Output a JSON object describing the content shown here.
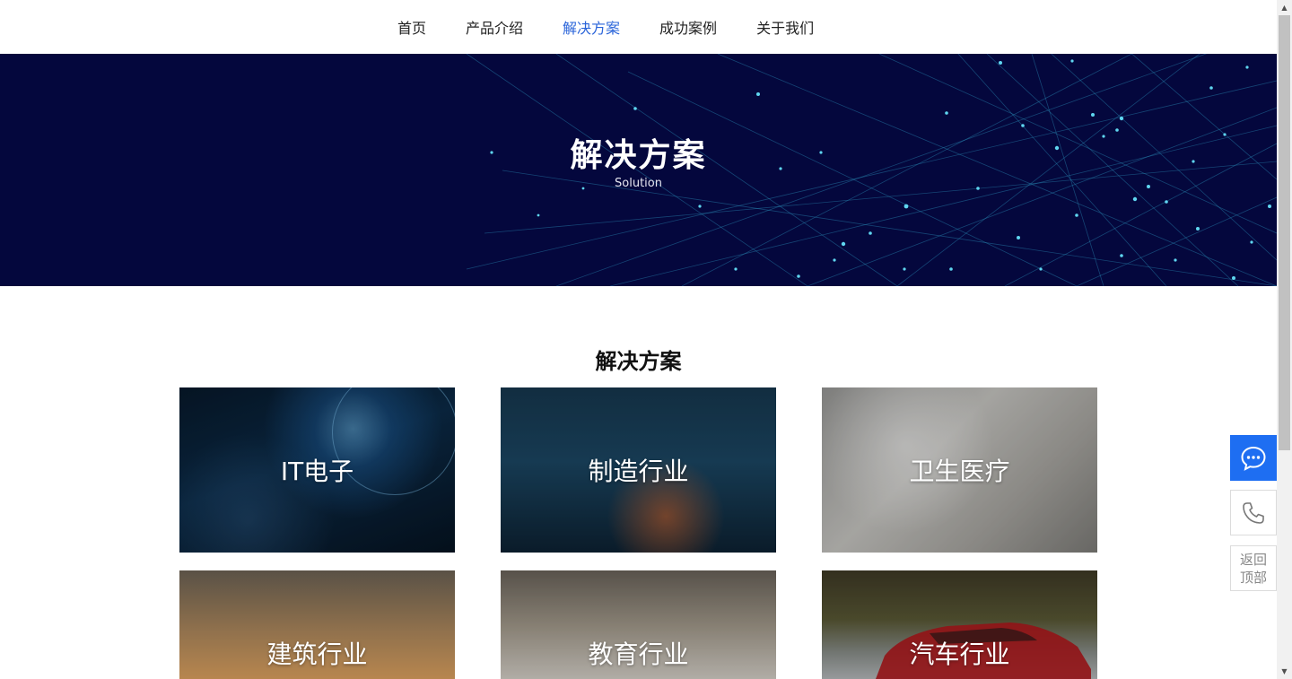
{
  "nav": {
    "items": [
      {
        "label": "首页",
        "active": false
      },
      {
        "label": "产品介绍",
        "active": false
      },
      {
        "label": "解决方案",
        "active": true
      },
      {
        "label": "成功案例",
        "active": false
      },
      {
        "label": "关于我们",
        "active": false
      }
    ]
  },
  "banner": {
    "title": "解决方案",
    "subtitle": "Solution"
  },
  "section": {
    "title": "解决方案"
  },
  "solutions": [
    {
      "label": "IT电子"
    },
    {
      "label": "制造行业"
    },
    {
      "label": "卫生医疗"
    },
    {
      "label": "建筑行业"
    },
    {
      "label": "教育行业"
    },
    {
      "label": "汽车行业"
    }
  ],
  "float_buttons": {
    "chat_icon": "chat-icon",
    "phone_icon": "phone-icon",
    "back_top_line1": "返回",
    "back_top_line2": "顶部"
  },
  "colors": {
    "accent": "#2a64d9",
    "banner_bg": "#04073d",
    "chat_button": "#1e6ef2"
  }
}
